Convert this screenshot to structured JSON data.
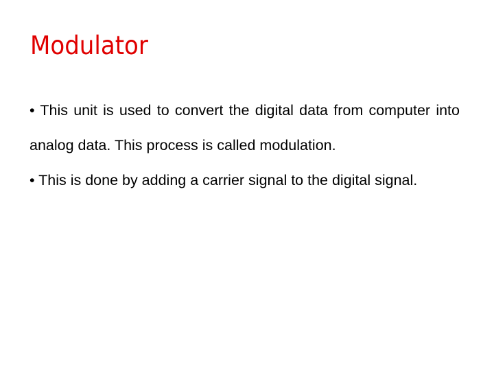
{
  "slide": {
    "title": "Modulator",
    "title_color": "#e00000",
    "bullets": [
      "• This unit is used to convert the digital data from computer into analog data. This process is called modulation.",
      "• This is done by adding a carrier signal to the digital signal."
    ]
  }
}
